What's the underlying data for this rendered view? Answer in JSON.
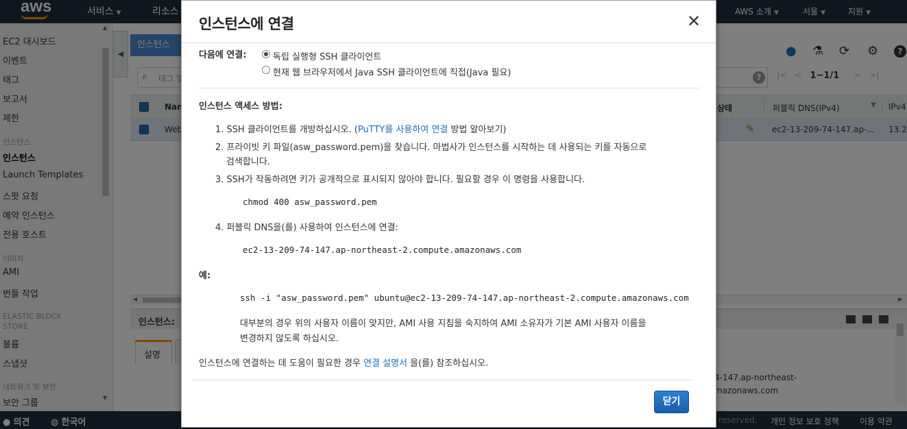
{
  "topnav": {
    "logo": "aws",
    "services": "서비스",
    "resources": "리소스",
    "aws_intro": "AWS 소개",
    "region": "서울",
    "support": "지원"
  },
  "sidebar": {
    "items": [
      {
        "label": "EC2 대시보드"
      },
      {
        "label": "이벤트"
      },
      {
        "label": "태그"
      },
      {
        "label": "보고서"
      },
      {
        "label": "제한"
      }
    ],
    "section_instances": "인스턴스",
    "instance_items": [
      {
        "label": "인스턴스"
      },
      {
        "label": "Launch Templates"
      },
      {
        "label": "스팟 요청"
      },
      {
        "label": "예약 인스턴스"
      },
      {
        "label": "전용 호스트"
      }
    ],
    "section_images": "이미지",
    "image_items": [
      {
        "label": "AMI"
      },
      {
        "label": "번들 작업"
      }
    ],
    "section_ebs_1": "ELASTIC BLOCK",
    "section_ebs_2": "STORE",
    "ebs_items": [
      {
        "label": "볼륨"
      },
      {
        "label": "스냅샷"
      }
    ],
    "section_network": "네트워크 및 보안",
    "network_items": [
      {
        "label": "보안 그룹"
      }
    ]
  },
  "content": {
    "launch_btn": "인스턴스",
    "search_placeholder": "태그 및",
    "pager": "1~1/1",
    "table": {
      "headers": [
        "Nam",
        "상태",
        "퍼블릭 DNS(IPv4)",
        "IPv4"
      ],
      "row": [
        "Web",
        "ec2-13-209-74-147.ap-...",
        "13.2"
      ]
    },
    "detail_label": "인스턴스:",
    "detail_tab": "설명",
    "detail_text_1": "4-147.ap-northeast-",
    "detail_text_2": "mazonaws.com"
  },
  "footer": {
    "feedback": "의견",
    "language": "한국어",
    "reserved": "reserved.",
    "privacy": "개인 정보 보호 정책",
    "terms": "이용 약관"
  },
  "modal": {
    "title": "인스턴스에 연결",
    "connect_label": "다음에 연결:",
    "option_standalone": "독립 실행형 SSH 클라이언트",
    "option_java": "현재 웹 브라우저에서 Java SSH 클라이언트에 직접(Java 필요)",
    "access_heading": "인스턴스 액세스 방법:",
    "step1_pre": "1. SSH 클라이언트를 개방하십시오. (",
    "step1_link": "PuTTY를 사용하여 연결",
    "step1_post": " 방법 알아보기)",
    "step2_line1": "2. 프라이빗 키 파일(asw_password.pem)을 찾습니다. 마법사가 인스턴스를 시작하는 데 사용되는 키를 자동으로",
    "step2_line2": "검색합니다.",
    "step3": "3. SSH가 작동하려면 키가 공개적으로 표시되지 않아야 합니다. 필요할 경우 이 명령을 사용합니다.",
    "chmod_cmd": "chmod 400 asw_password.pem",
    "step4": "4. 퍼블릭 DNS을(를) 사용하여 인스턴스에 연결:",
    "public_dns": "ec2-13-209-74-147.ap-northeast-2.compute.amazonaws.com",
    "example_label": "예:",
    "ssh_cmd": "ssh -i \"asw_password.pem\" ubuntu@ec2-13-209-74-147.ap-northeast-2.compute.amazonaws.com",
    "note_line1": "대부분의 경우 위의 사용자 이름이 맞지만, AMI 사용 지침을 숙지하여 AMI 소유자가 기본 AMI 사용자 이름을",
    "note_line2": "변경하지 않도록 하십시오.",
    "help_pre": "인스턴스에 연결하는 데 도움이 필요한 경우 ",
    "help_link": "연결 설명서",
    "help_post": " 을(를) 참조하십시오.",
    "close_button": "닫기"
  },
  "colors": {
    "nav_bg": "#232f3e",
    "accent": "#f90",
    "link": "#1f6fb6",
    "primary_button": "#1a5ea8"
  }
}
